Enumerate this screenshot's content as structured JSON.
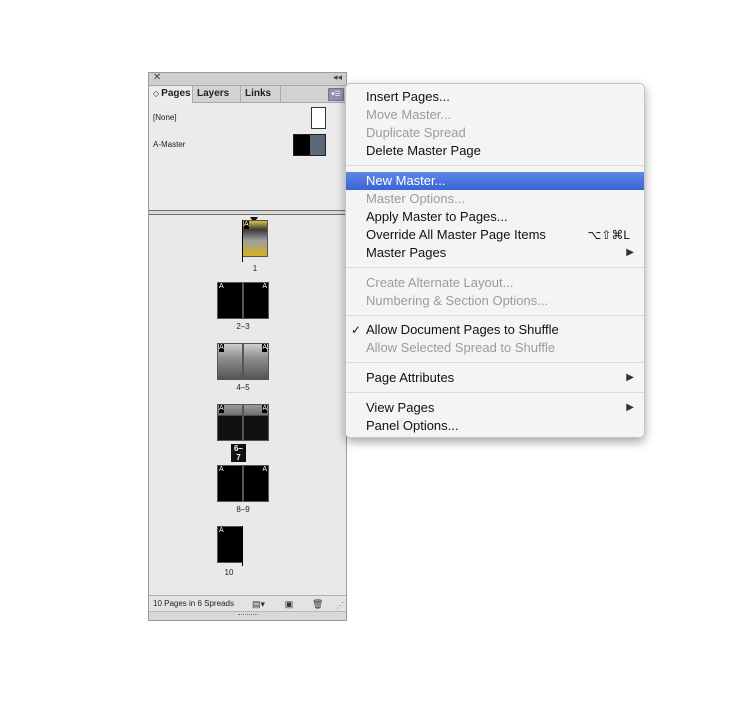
{
  "panel": {
    "tabs": [
      "Pages",
      "Layers",
      "Links"
    ],
    "masters": [
      "[None]",
      "A-Master"
    ],
    "status": "10 Pages in 6 Spreads",
    "spreads": [
      {
        "label": "1",
        "prefixes": [
          "A"
        ],
        "selected": false
      },
      {
        "label": "2–3",
        "prefixes": [
          "A",
          "A"
        ],
        "selected": false
      },
      {
        "label": "4–5",
        "prefixes": [
          "A",
          "A"
        ],
        "selected": false
      },
      {
        "label": "6–7",
        "prefixes": [
          "A",
          "A"
        ],
        "selected": true
      },
      {
        "label": "8–9",
        "prefixes": [
          "A",
          "A"
        ],
        "selected": false
      },
      {
        "label": "10",
        "prefixes": [
          "A"
        ],
        "selected": false
      }
    ]
  },
  "menu": {
    "items": [
      {
        "label": "Insert Pages...",
        "enabled": true
      },
      {
        "label": "Move Master...",
        "enabled": false
      },
      {
        "label": "Duplicate Spread",
        "enabled": false
      },
      {
        "label": "Delete Master Page",
        "enabled": true
      },
      {
        "label": "New Master...",
        "enabled": true,
        "highlighted": true
      },
      {
        "label": "Master Options...",
        "enabled": false
      },
      {
        "label": "Apply Master to Pages...",
        "enabled": true
      },
      {
        "label": "Override All Master Page Items",
        "enabled": true,
        "shortcut": "⌥⇧⌘L"
      },
      {
        "label": "Master Pages",
        "enabled": true,
        "submenu": true
      },
      {
        "label": "Create Alternate Layout...",
        "enabled": false
      },
      {
        "label": "Numbering & Section Options...",
        "enabled": false
      },
      {
        "label": "Allow Document Pages to Shuffle",
        "enabled": true,
        "checked": true
      },
      {
        "label": "Allow Selected Spread to Shuffle",
        "enabled": false
      },
      {
        "label": "Page Attributes",
        "enabled": true,
        "submenu": true
      },
      {
        "label": "View Pages",
        "enabled": true,
        "submenu": true
      },
      {
        "label": "Panel Options...",
        "enabled": true
      }
    ],
    "check_glyph": "✓",
    "submenu_glyph": "▶",
    "highlight_color": "#3d6ad8"
  }
}
